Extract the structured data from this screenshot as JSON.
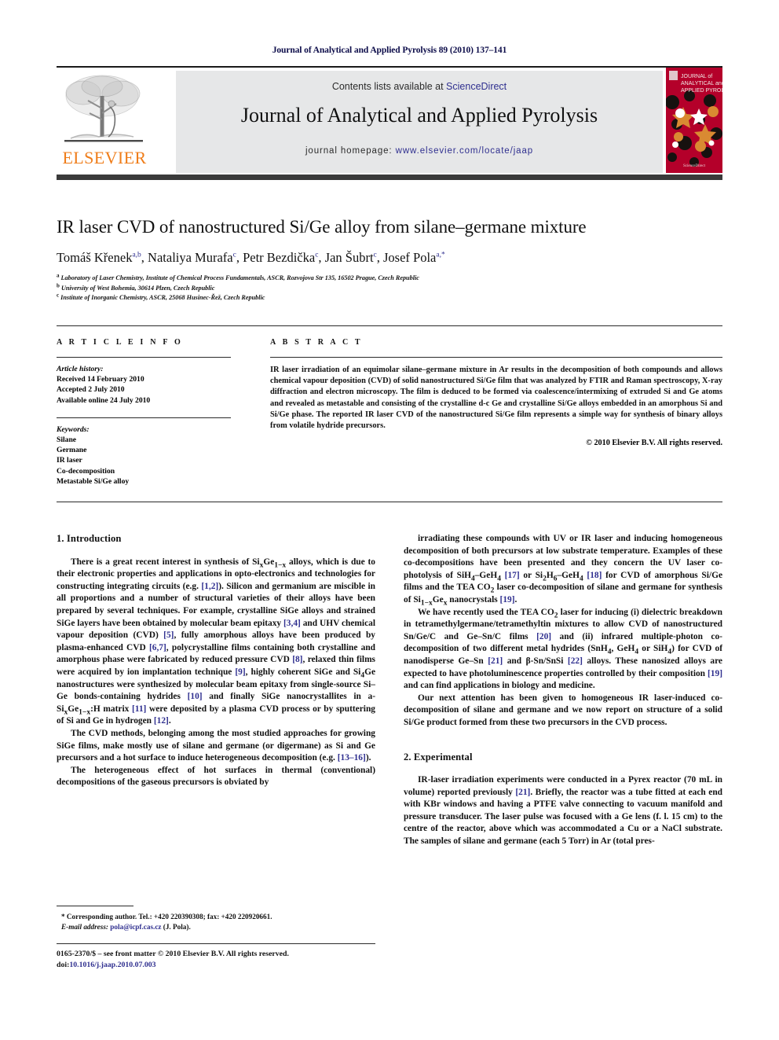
{
  "running_head": "Journal of Analytical and Applied Pyrolysis 89 (2010) 137–141",
  "masthead": {
    "contents_prefix": "Contents lists available at ",
    "sciencedirect": "ScienceDirect",
    "journal_title": "Journal of Analytical and Applied Pyrolysis",
    "homepage_prefix": "journal homepage: ",
    "homepage_url": "www.elsevier.com/locate/jaap",
    "publisher_wordmark": "ELSEVIER",
    "publisher_color": "#ef7d1a",
    "cover_title_lines": [
      "JOURNAL of",
      "ANALYTICAL and",
      "APPLIED PYROLYSIS"
    ],
    "cover_color": "#b4002a",
    "link_color": "#2f2f8f"
  },
  "article": {
    "title": "IR laser CVD of nanostructured Si/Ge alloy from silane–germane mixture",
    "authors_html": "Tomáš Křenek<sup>a,b</sup>, Nataliya Murafa<sup>c</sup>, Petr Bezdička<sup>c</sup>, Jan Šubrt<sup>c</sup>, Josef Pola<sup>a,</sup><sup>*</sup>",
    "affiliations": [
      {
        "mark": "a",
        "text": "Laboratory of Laser Chemistry, Institute of Chemical Process Fundamentals, ASCR, Rozvojova Str 135, 16502 Prague, Czech Republic"
      },
      {
        "mark": "b",
        "text": "University of West Bohemia, 30614 Plzen, Czech Republic"
      },
      {
        "mark": "c",
        "text": "Institute of Inorganic Chemistry, ASCR, 25068 Husinec-Řež, Czech Republic"
      }
    ]
  },
  "article_info": {
    "heading": "A R T I C L E    I N F O",
    "history_label": "Article history:",
    "history": [
      "Received 14 February 2010",
      "Accepted 2 July 2010",
      "Available online 24 July 2010"
    ],
    "keywords_label": "Keywords:",
    "keywords": [
      "Silane",
      "Germane",
      "IR laser",
      "Co-decomposition",
      "Metastable Si/Ge alloy"
    ]
  },
  "abstract": {
    "heading": "A B S T R A C T",
    "text": "IR laser irradiation of an equimolar silane–germane mixture in Ar results in the decomposition of both compounds and allows chemical vapour deposition (CVD) of solid nanostructured Si/Ge film that was analyzed by FTIR and Raman spectroscopy, X-ray diffraction and electron microscopy. The film is deduced to be formed via coalescence/intermixing of extruded Si and Ge atoms and revealed as metastable and consisting of the crystalline d-c Ge and crystalline Si/Ge alloys embedded in an amorphous Si and Si/Ge phase. The reported IR laser CVD of the nanostructured Si/Ge film represents a simple way for synthesis of binary alloys from volatile hydride precursors.",
    "copyright": "© 2010 Elsevier B.V. All rights reserved."
  },
  "sections": {
    "introduction_heading": "1.  Introduction",
    "experimental_heading": "2.  Experimental",
    "intro_p1": "There is a great recent interest in synthesis of Si<sub>x</sub>Ge<sub>1−x</sub> alloys, which is due to their electronic properties and applications in opto-electronics and technologies for constructing integrating circuits (e.g. <span class=\"ref\">[1,2]</span>). Silicon and germanium are miscible in all proportions and a number of structural varieties of their alloys have been prepared by several techniques. For example, crystalline SiGe alloys and strained SiGe layers have been obtained by molecular beam epitaxy <span class=\"ref\">[3,4]</span> and UHV chemical vapour deposition (CVD) <span class=\"ref\">[5]</span>, fully amorphous alloys have been produced by plasma-enhanced CVD <span class=\"ref\">[6,7]</span>, polycrystalline films containing both crystalline and amorphous phase were fabricated by reduced pressure CVD <span class=\"ref\">[8]</span>, relaxed thin films were acquired by ion implantation technique <span class=\"ref\">[9]</span>, highly coherent SiGe and Si<sub>4</sub>Ge nanostructures were synthesized by molecular beam epitaxy from single-source Si–Ge bonds-containing hydrides <span class=\"ref\">[10]</span> and finally SiGe nanocrystallites in a-Si<sub>x</sub>Ge<sub>1−x</sub>:H matrix <span class=\"ref\">[11]</span> were deposited by a plasma CVD process or by sputtering of Si and Ge in hydrogen <span class=\"ref\">[12]</span>.",
    "intro_p2": "The CVD methods, belonging among the most studied approaches for growing SiGe films, make mostly use of silane and germane (or digermane) as Si and Ge precursors and a hot surface to induce heterogeneous decomposition (e.g. <span class=\"ref\">[13–16]</span>).",
    "intro_p3": "The heterogeneous effect of hot surfaces in thermal (conventional) decompositions of the gaseous precursors is obviated by",
    "intro_p4": "irradiating these compounds with UV or IR laser and inducing homogeneous decomposition of both precursors at low substrate temperature. Examples of these co-decompositions have been presented and they concern the UV laser co-photolysis of SiH<sub>4</sub>–GeH<sub>4</sub> <span class=\"ref\">[17]</span> or Si<sub>2</sub>H<sub>6</sub>–GeH<sub>4</sub> <span class=\"ref\">[18]</span> for CVD of amorphous Si/Ge films and the TEA CO<sub>2</sub> laser co-decomposition of silane and germane for synthesis of Si<sub>1−x</sub>Ge<sub>x</sub> nanocrystals <span class=\"ref\">[19]</span>.",
    "intro_p5": "We have recently used the TEA CO<sub>2</sub> laser for inducing (i) dielectric breakdown in tetramethylgermane/tetramethyltin mixtures to allow CVD of nanostructured Sn/Ge/C and Ge–Sn/C films <span class=\"ref\">[20]</span> and (ii) infrared multiple-photon co-decomposition of two different metal hydrides (SnH<sub>4</sub>, GeH<sub>4</sub> or SiH<sub>4</sub>) for CVD of nanodisperse Ge–Sn <span class=\"ref\">[21]</span> and β-Sn/SnSi <span class=\"ref\">[22]</span> alloys. These nanosized alloys are expected to have photoluminescence properties controlled by their composition <span class=\"ref\">[19]</span> and can find applications in biology and medicine.",
    "intro_p6": "Our next attention has been given to homogeneous IR laser-induced co-decomposition of silane and germane and we now report on structure of a solid Si/Ge product formed from these two precursors in the CVD process.",
    "exp_p1": "IR-laser irradiation experiments were conducted in a Pyrex reactor (70 mL in volume) reported previously <span class=\"ref\">[21]</span>. Briefly, the reactor was a tube fitted at each end with KBr windows and having a PTFE valve connecting to vacuum manifold and pressure transducer. The laser pulse was focused with a Ge lens (f. l. 15 cm) to the centre of the reactor, above which was accommodated a Cu or a NaCl substrate. The samples of silane and germane (each 5 Torr) in Ar (total pres-"
  },
  "footnote": {
    "line1": "* Corresponding author. Tel.: +420 220390308; fax: +420 220920661.",
    "email_label": "E-mail address:",
    "email": "pola@icpf.cas.cz",
    "email_suffix": "(J. Pola)."
  },
  "imprint": {
    "line1": "0165-2370/$ – see front matter © 2010 Elsevier B.V. All rights reserved.",
    "doi_label": "doi:",
    "doi": "10.1016/j.jaap.2010.07.003"
  }
}
